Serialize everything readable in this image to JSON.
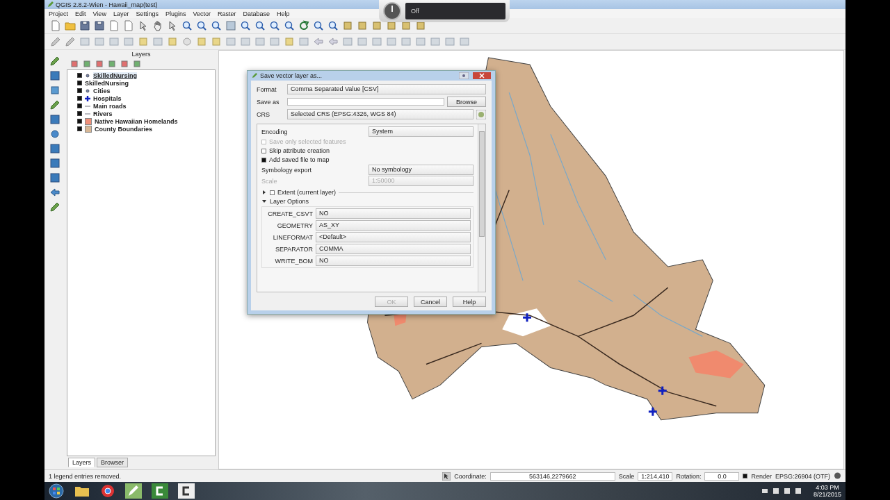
{
  "window": {
    "title": "QGIS 2.8.2-Wien - Hawaii_map(test)"
  },
  "menu": [
    "Project",
    "Edit",
    "View",
    "Layer",
    "Settings",
    "Plugins",
    "Vector",
    "Raster",
    "Database",
    "Help"
  ],
  "layers_panel": {
    "title": "Layers",
    "layers": [
      {
        "name": "SkilledNursing",
        "visible": true,
        "kind": "point",
        "selected": true
      },
      {
        "name": "SkilledNursing",
        "visible": true,
        "kind": "plain",
        "selected": false
      },
      {
        "name": "Cities",
        "visible": true,
        "kind": "point",
        "selected": false
      },
      {
        "name": "Hospitals",
        "visible": true,
        "kind": "cross",
        "selected": false
      },
      {
        "name": "Main roads",
        "visible": true,
        "kind": "line",
        "selected": false
      },
      {
        "name": "Rivers",
        "visible": true,
        "kind": "line",
        "selected": false
      },
      {
        "name": "Native Hawaiian Homelands",
        "visible": true,
        "kind": "fill",
        "color": "#f0907a",
        "selected": false
      },
      {
        "name": "County Boundaries",
        "visible": true,
        "kind": "fill",
        "color": "#d8b896",
        "selected": false
      }
    ],
    "tabs": [
      {
        "label": "Layers",
        "selected": true
      },
      {
        "label": "Browser",
        "selected": false
      }
    ]
  },
  "dialog": {
    "title": "Save vector layer as...",
    "format": {
      "label": "Format",
      "value": "Comma Separated Value [CSV]"
    },
    "save_as": {
      "label": "Save as",
      "button": "Browse"
    },
    "crs": {
      "label": "CRS",
      "value": "Selected CRS (EPSG:4326, WGS 84)"
    },
    "encoding": {
      "label": "Encoding",
      "value": "System"
    },
    "options": [
      {
        "label": "Save only selected features",
        "checked": false,
        "disabled": true
      },
      {
        "label": "Skip attribute creation",
        "checked": false,
        "disabled": false
      },
      {
        "label": "Add saved file to map",
        "checked": true,
        "disabled": false
      }
    ],
    "symbology": {
      "label": "Symbology export",
      "value": "No symbology"
    },
    "scale": {
      "label": "Scale",
      "value": "1:50000",
      "disabled": true
    },
    "extent": {
      "label": "Extent (current layer)",
      "checked": false,
      "expanded": false
    },
    "layer_options": {
      "title": "Layer Options",
      "expanded": true,
      "rows": [
        {
          "name": "CREATE_CSVT",
          "value": "NO"
        },
        {
          "name": "GEOMETRY",
          "value": "AS_XY"
        },
        {
          "name": "LINEFORMAT",
          "value": "<Default>"
        },
        {
          "name": "SEPARATOR",
          "value": "COMMA"
        },
        {
          "name": "WRITE_BOM",
          "value": "NO"
        }
      ]
    },
    "buttons": [
      {
        "label": "OK",
        "disabled": true
      },
      {
        "label": "Cancel",
        "disabled": false
      },
      {
        "label": "Help",
        "disabled": false
      }
    ]
  },
  "overlay": {
    "label": "Off"
  },
  "status_bar": {
    "message": "1 legend entries removed.",
    "coordinate_label": "Coordinate:",
    "coordinate": "563146,2279662",
    "scale_label": "Scale",
    "scale": "1:214,410",
    "rotation_label": "Rotation:",
    "rotation": "0.0",
    "render": {
      "label": "Render",
      "checked": true
    },
    "crs": "EPSG:26904 (OTF)"
  },
  "taskbar": {
    "time": "4:03 PM",
    "date": "8/21/2015"
  }
}
